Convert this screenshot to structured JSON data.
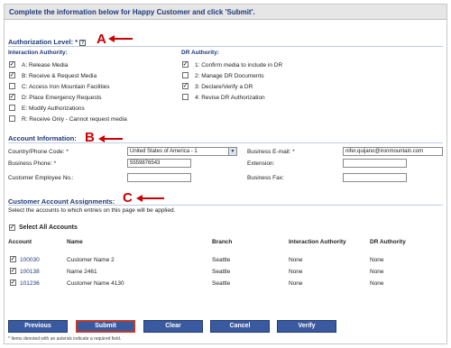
{
  "banner": {
    "text": "Complete the information below for Happy Customer and click 'Submit'."
  },
  "annotations": {
    "a": "A",
    "b": "B",
    "c": "C"
  },
  "authorization": {
    "title": "Authorization Level: *",
    "help_glyph": "?",
    "interaction_heading": "Interaction Authority:",
    "dr_heading": "DR Authority:",
    "interaction_items": [
      {
        "label": "A: Release Media",
        "checked": true
      },
      {
        "label": "B: Receive & Request Media",
        "checked": true
      },
      {
        "label": "C: Access Iron Mountain Facilities",
        "checked": false
      },
      {
        "label": "D: Place Emergency Requests",
        "checked": true
      },
      {
        "label": "E: Modify Authorizations",
        "checked": false
      },
      {
        "label": "R: Receive Only - Cannot request media",
        "checked": false
      }
    ],
    "dr_items": [
      {
        "label": "1: Confirm media to include in DR",
        "checked": true
      },
      {
        "label": "2: Manage DR Documents",
        "checked": false
      },
      {
        "label": "3: Declare/Verify a DR",
        "checked": true
      },
      {
        "label": "4: Revise DR Authorization",
        "checked": false
      }
    ]
  },
  "account": {
    "title": "Account Information:",
    "country_label": "Country/Phone Code: *",
    "country_value": "United States of America - 1",
    "business_phone_label": "Business Phone: *",
    "business_phone_value": "5559876543",
    "employee_no_label": "Customer Employee No.:",
    "employee_no_value": "",
    "email_label": "Business E-mail: *",
    "email_value": "nifer.quijano@ironmountain.com",
    "extension_label": "Extension:",
    "extension_value": "",
    "fax_label": "Business Fax:",
    "fax_value": ""
  },
  "assignments": {
    "title": "Customer Account Assignments:",
    "instruction": "Select the accounts to which entries on this page will be applied.",
    "select_all_label": "Select All Accounts",
    "select_all_checked": true,
    "columns": [
      "Account",
      "Name",
      "Branch",
      "Interaction Authority",
      "DR Authority"
    ],
    "rows": [
      {
        "checked": true,
        "account": "100030",
        "name": "Customer Name 2",
        "branch": "Seattle",
        "interaction": "None",
        "dr": "None"
      },
      {
        "checked": true,
        "account": "100138",
        "name": "Name 2461",
        "branch": "Seattle",
        "interaction": "None",
        "dr": "None"
      },
      {
        "checked": true,
        "account": "101236",
        "name": "Customer Name 4130",
        "branch": "Seattle",
        "interaction": "None",
        "dr": "None"
      }
    ]
  },
  "buttons": {
    "previous": "Previous",
    "submit": "Submit",
    "clear": "Clear",
    "cancel": "Cancel",
    "verify": "Verify"
  },
  "footnote": "* Items denoted with an asterisk indicate a required field.",
  "colors": {
    "accent": "#1f3a78",
    "button": "#3a5aa0",
    "annotation": "#cc0000"
  }
}
